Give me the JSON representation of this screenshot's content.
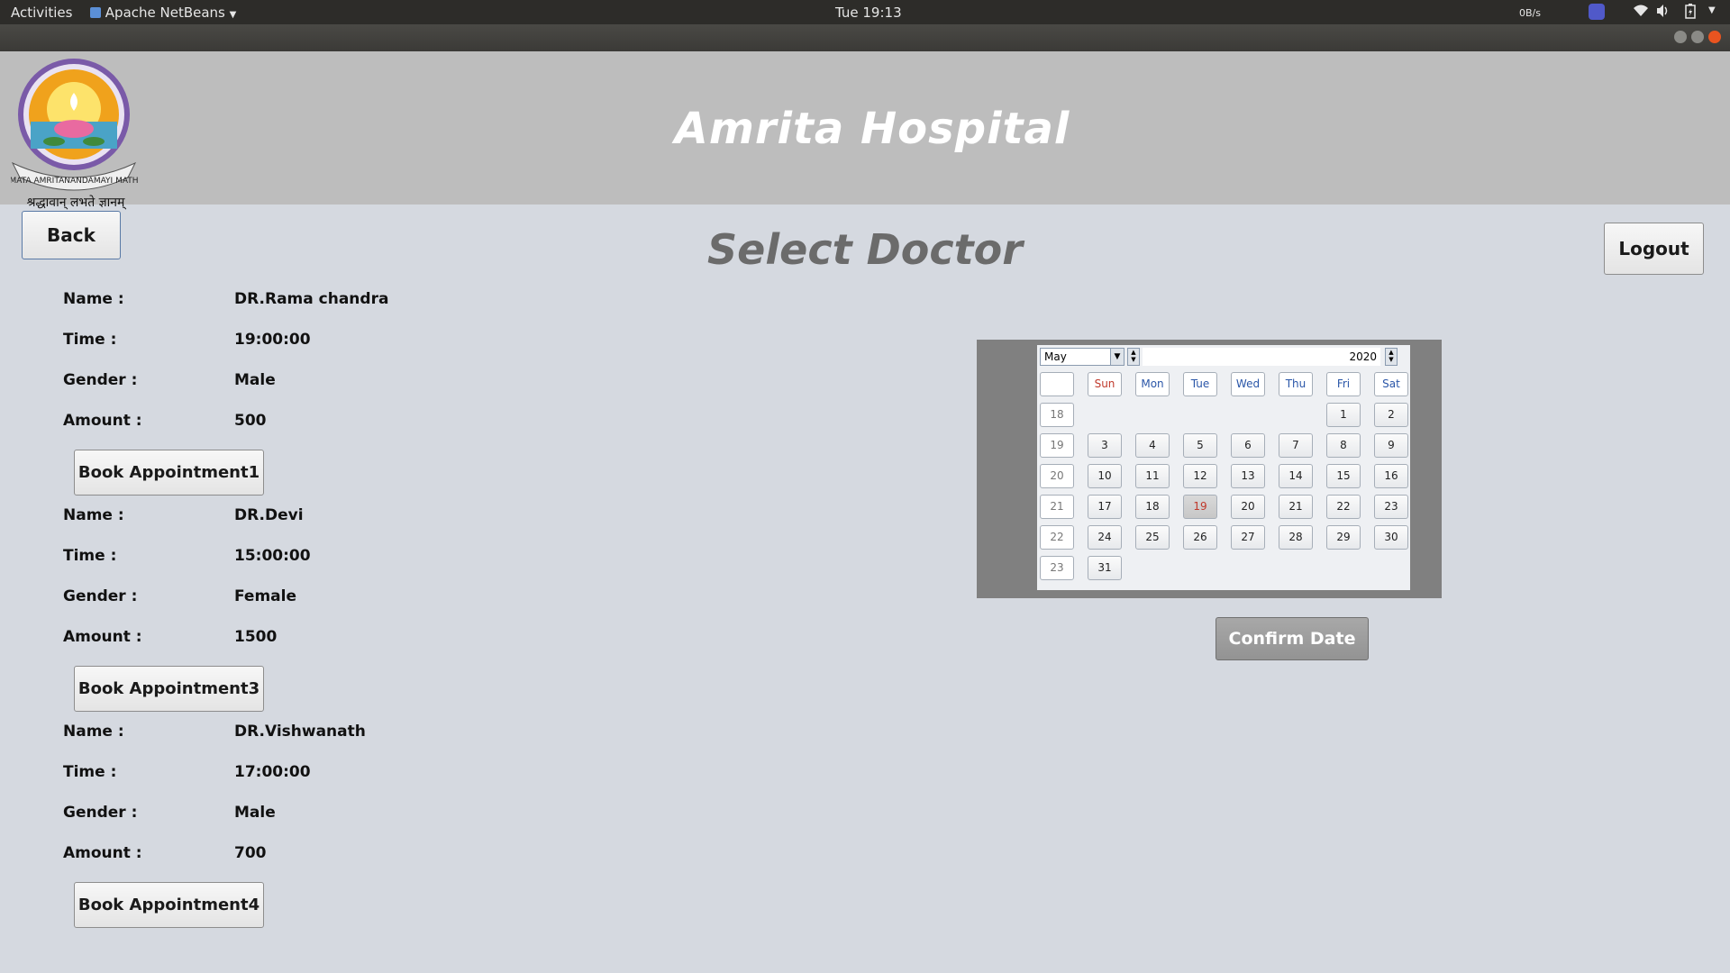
{
  "topbar": {
    "activities": "Activities",
    "app_name": "Apache NetBeans",
    "clock": "Tue 19:13",
    "net_speed": "0B/s"
  },
  "header": {
    "hospital_title": "Amrita Hospital",
    "logo_caption": "श्रद्धावान् लभते ज्ञानम्",
    "logo_ring_text": "MATA AMRITANANDAMAYI MATH"
  },
  "nav": {
    "back_label": "Back",
    "logout_label": "Logout"
  },
  "page_title": "Select Doctor",
  "doctors": [
    {
      "name_label": "Name :",
      "name": "DR.Rama chandra",
      "time_label": "Time :",
      "time": "19:00:00",
      "gender_label": "Gender :",
      "gender": "Male",
      "amount_label": "Amount :",
      "amount": "500",
      "button": "Book Appointment1"
    },
    {
      "name_label": "Name :",
      "name": "DR.Devi",
      "time_label": "Time :",
      "time": "15:00:00",
      "gender_label": "Gender :",
      "gender": "Female",
      "amount_label": "Amount :",
      "amount": "1500",
      "button": "Book Appointment3"
    },
    {
      "name_label": "Name :",
      "name": "DR.Vishwanath",
      "time_label": "Time :",
      "time": "17:00:00",
      "gender_label": "Gender :",
      "gender": "Male",
      "amount_label": "Amount :",
      "amount": "700",
      "button": "Book Appointment4"
    }
  ],
  "calendar": {
    "month": "May",
    "year": "2020",
    "weekdays": [
      "Sun",
      "Mon",
      "Tue",
      "Wed",
      "Thu",
      "Fri",
      "Sat"
    ],
    "weeks": [
      {
        "week": "18",
        "days": [
          "",
          "",
          "",
          "",
          "",
          "1",
          "2"
        ]
      },
      {
        "week": "19",
        "days": [
          "3",
          "4",
          "5",
          "6",
          "7",
          "8",
          "9"
        ]
      },
      {
        "week": "20",
        "days": [
          "10",
          "11",
          "12",
          "13",
          "14",
          "15",
          "16"
        ]
      },
      {
        "week": "21",
        "days": [
          "17",
          "18",
          "19",
          "20",
          "21",
          "22",
          "23"
        ]
      },
      {
        "week": "22",
        "days": [
          "24",
          "25",
          "26",
          "27",
          "28",
          "29",
          "30"
        ]
      },
      {
        "week": "23",
        "days": [
          "31",
          "",
          "",
          "",
          "",
          "",
          ""
        ]
      }
    ],
    "selected_day": "19",
    "confirm_label": "Confirm Date"
  },
  "colors": {
    "background": "#d5d9e0",
    "header": "#bdbdbd",
    "title_text": "#ffffff",
    "page_title_text": "#6b6b6b",
    "calendar_frame": "#808080",
    "sunday_red": "#c0392b",
    "weekday_blue": "#2a56a8"
  }
}
